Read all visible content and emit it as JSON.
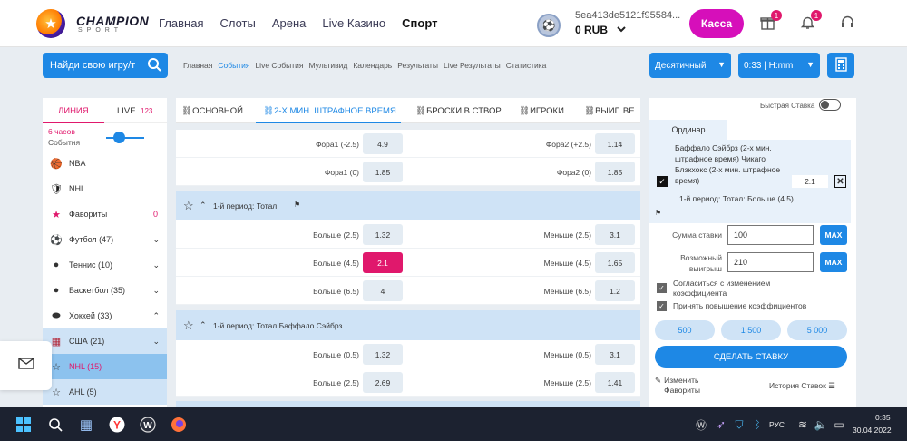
{
  "brand": {
    "title": "CHAMPION",
    "sub": "SPORT"
  },
  "nav": [
    {
      "label": "Главная"
    },
    {
      "label": "Слоты"
    },
    {
      "label": "Арена"
    },
    {
      "label": "Live Казино"
    },
    {
      "label": "Спорт"
    }
  ],
  "account": {
    "id": "5ea413de5121f95584...",
    "balance": "0 RUB"
  },
  "header": {
    "cashier": "Касса",
    "gift_badge": "1",
    "notif_badge": "1"
  },
  "search": {
    "placeholder": "Найди свою игру/т"
  },
  "subnav": [
    {
      "label": "Главная"
    },
    {
      "label": "События"
    },
    {
      "label": "Live События"
    },
    {
      "label": "Мультивид"
    },
    {
      "label": "Календарь"
    },
    {
      "label": "Результаты"
    },
    {
      "label": "Live Результаты"
    },
    {
      "label": "Статистика"
    }
  ],
  "odds_format": "Десятичный",
  "time_format": "0:33 | H:mm",
  "left": {
    "tab_line": "ЛИНИЯ",
    "tab_live": "LIVE",
    "live_count": "123",
    "hours": "6 часов",
    "events": "События",
    "items": [
      {
        "label": "NBA",
        "icon": "nba-icon",
        "glyph": "🏀"
      },
      {
        "label": "NHL",
        "icon": "nhl-icon",
        "glyph": "🛡"
      },
      {
        "label": "Фавориты",
        "icon": "star-icon",
        "glyph": "★",
        "count": "0"
      },
      {
        "label": "Футбол (47)",
        "icon": "football-icon",
        "glyph": "⚽"
      },
      {
        "label": "Теннис (10)",
        "icon": "tennis-icon",
        "glyph": "●"
      },
      {
        "label": "Баскетбол (35)",
        "icon": "basketball-icon",
        "glyph": "●"
      },
      {
        "label": "Хоккей (33)",
        "icon": "hockey-icon",
        "glyph": "⬬"
      },
      {
        "label": "США (21)",
        "icon": "usa-flag-icon",
        "glyph": "▦"
      },
      {
        "label": "NHL (15)",
        "icon": "star-icon",
        "glyph": "☆"
      },
      {
        "label": "AHL (5)",
        "icon": "star-icon",
        "glyph": "☆"
      }
    ]
  },
  "market_tabs": [
    {
      "label": "ОСНОВНОЙ"
    },
    {
      "label": "2-Х МИН. ШТРАФНОЕ ВРЕМЯ"
    },
    {
      "label": "БРОСКИ В СТВОР"
    },
    {
      "label": "ИГРОКИ"
    },
    {
      "label": "ВЫИГ. ВЕ"
    }
  ],
  "fora_rows": [
    {
      "l_label": "Фора1 (-2.5)",
      "l_val": "4.9",
      "r_label": "Фора2 (+2.5)",
      "r_val": "1.14"
    },
    {
      "l_label": "Фора1 (0)",
      "l_val": "1.85",
      "r_label": "Фора2 (0)",
      "r_val": "1.85"
    }
  ],
  "groups": [
    {
      "title": "1-й период: Тотал",
      "rows": [
        {
          "l_label": "Больше (2.5)",
          "l_val": "1.32",
          "r_label": "Меньше (2.5)",
          "r_val": "3.1"
        },
        {
          "l_label": "Больше (4.5)",
          "l_val": "2.1",
          "r_label": "Меньше (4.5)",
          "r_val": "1.65"
        },
        {
          "l_label": "Больше (6.5)",
          "l_val": "4",
          "r_label": "Меньше (6.5)",
          "r_val": "1.2"
        }
      ]
    },
    {
      "title": "1-й период: Тотал Баффало Сэйбрз",
      "rows": [
        {
          "l_label": "Больше (0.5)",
          "l_val": "1.32",
          "r_label": "Меньше (0.5)",
          "r_val": "3.1"
        },
        {
          "l_label": "Больше (2.5)",
          "l_val": "2.69",
          "r_label": "Меньше (2.5)",
          "r_val": "1.41"
        }
      ]
    }
  ],
  "betslip": {
    "quick_bet": "Быстрая Ставка",
    "tab": "Ординар",
    "event": "Баффало Сэйбрз (2-х мин. штрафное время) Чикаго Блэкхокс (2-х мин. штрафное время)",
    "odd": "2.1",
    "market": "1-й период: Тотал: Больше (4.5)",
    "stake_label": "Сумма ставки",
    "stake": "100",
    "win_label": "Возможный выигрыш",
    "win": "210",
    "max": "MAX",
    "agree": "Согласиться с изменением коэффициента",
    "accept": "Принять повышение коэффициентов",
    "quick": [
      "500",
      "1 500",
      "5 000"
    ],
    "place": "СДЕЛАТЬ СТАВКУ",
    "edit_fav": "Изменить Фавориты",
    "history": "История Ставок"
  },
  "taskbar": {
    "lang": "РУС",
    "time": "0:35",
    "date": "30.04.2022"
  },
  "colors": {
    "accent": "#1e88e5",
    "pink": "#e0186c",
    "cashier": "#d60fba"
  }
}
